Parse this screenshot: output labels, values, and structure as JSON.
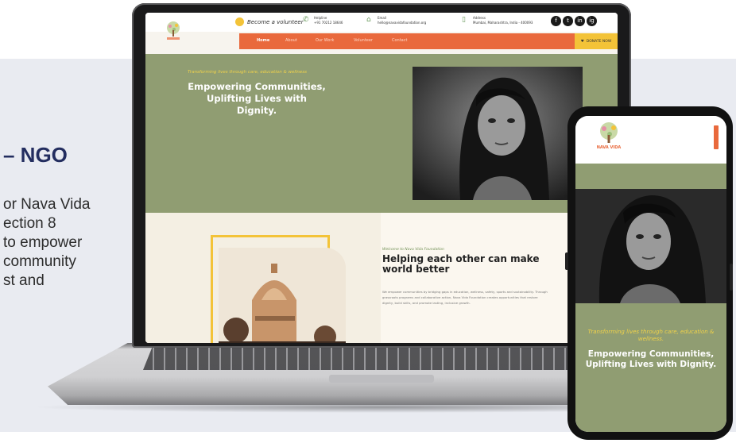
{
  "slide": {
    "title": "– NGO",
    "description": "or Nava Vida\nection 8\nto empower\n community\nst and"
  },
  "site": {
    "header": {
      "volunteer_label": "Become a volunteer",
      "phone_label": "Helpline",
      "phone_value": "+91 70212 18646",
      "email_label": "Email",
      "email_value": "hello@navavidafoundation.org",
      "address_label": "Address",
      "address_value": "Mumbai, Maharashtra, India - 400093",
      "social": [
        "f",
        "t",
        "in",
        "ig"
      ]
    },
    "nav": {
      "items": [
        "Home",
        "About",
        "Our Work",
        "Volunteer",
        "Contact"
      ],
      "active": "Home",
      "donate_label": "DONATE NOW"
    },
    "hero": {
      "tagline": "Transforming lives through care, education & wellness",
      "heading": "Empowering Communities, Uplifting Lives with Dignity."
    },
    "about": {
      "welcome": "Welcome to Nava Vida Foundation",
      "heading": "Helping each other can make world better",
      "paragraph": "We empower communities by bridging gaps in education, wellness, safety, sports and sustainability. Through grassroots programs and collaborative action, Nava Vida Foundation creates opportunities that restore dignity, build skills, and promote lasting, inclusive growth."
    },
    "mobile": {
      "logo_text": "NAVA VIDA",
      "tagline": "Transforming lives through care, education & wellness.",
      "heading": "Empowering Communities, Uplifting Lives with Dignity."
    }
  },
  "colors": {
    "accent_orange": "#e9693c",
    "accent_yellow": "#f3c338",
    "hero_green": "#909d72",
    "title_navy": "#232d5f"
  }
}
